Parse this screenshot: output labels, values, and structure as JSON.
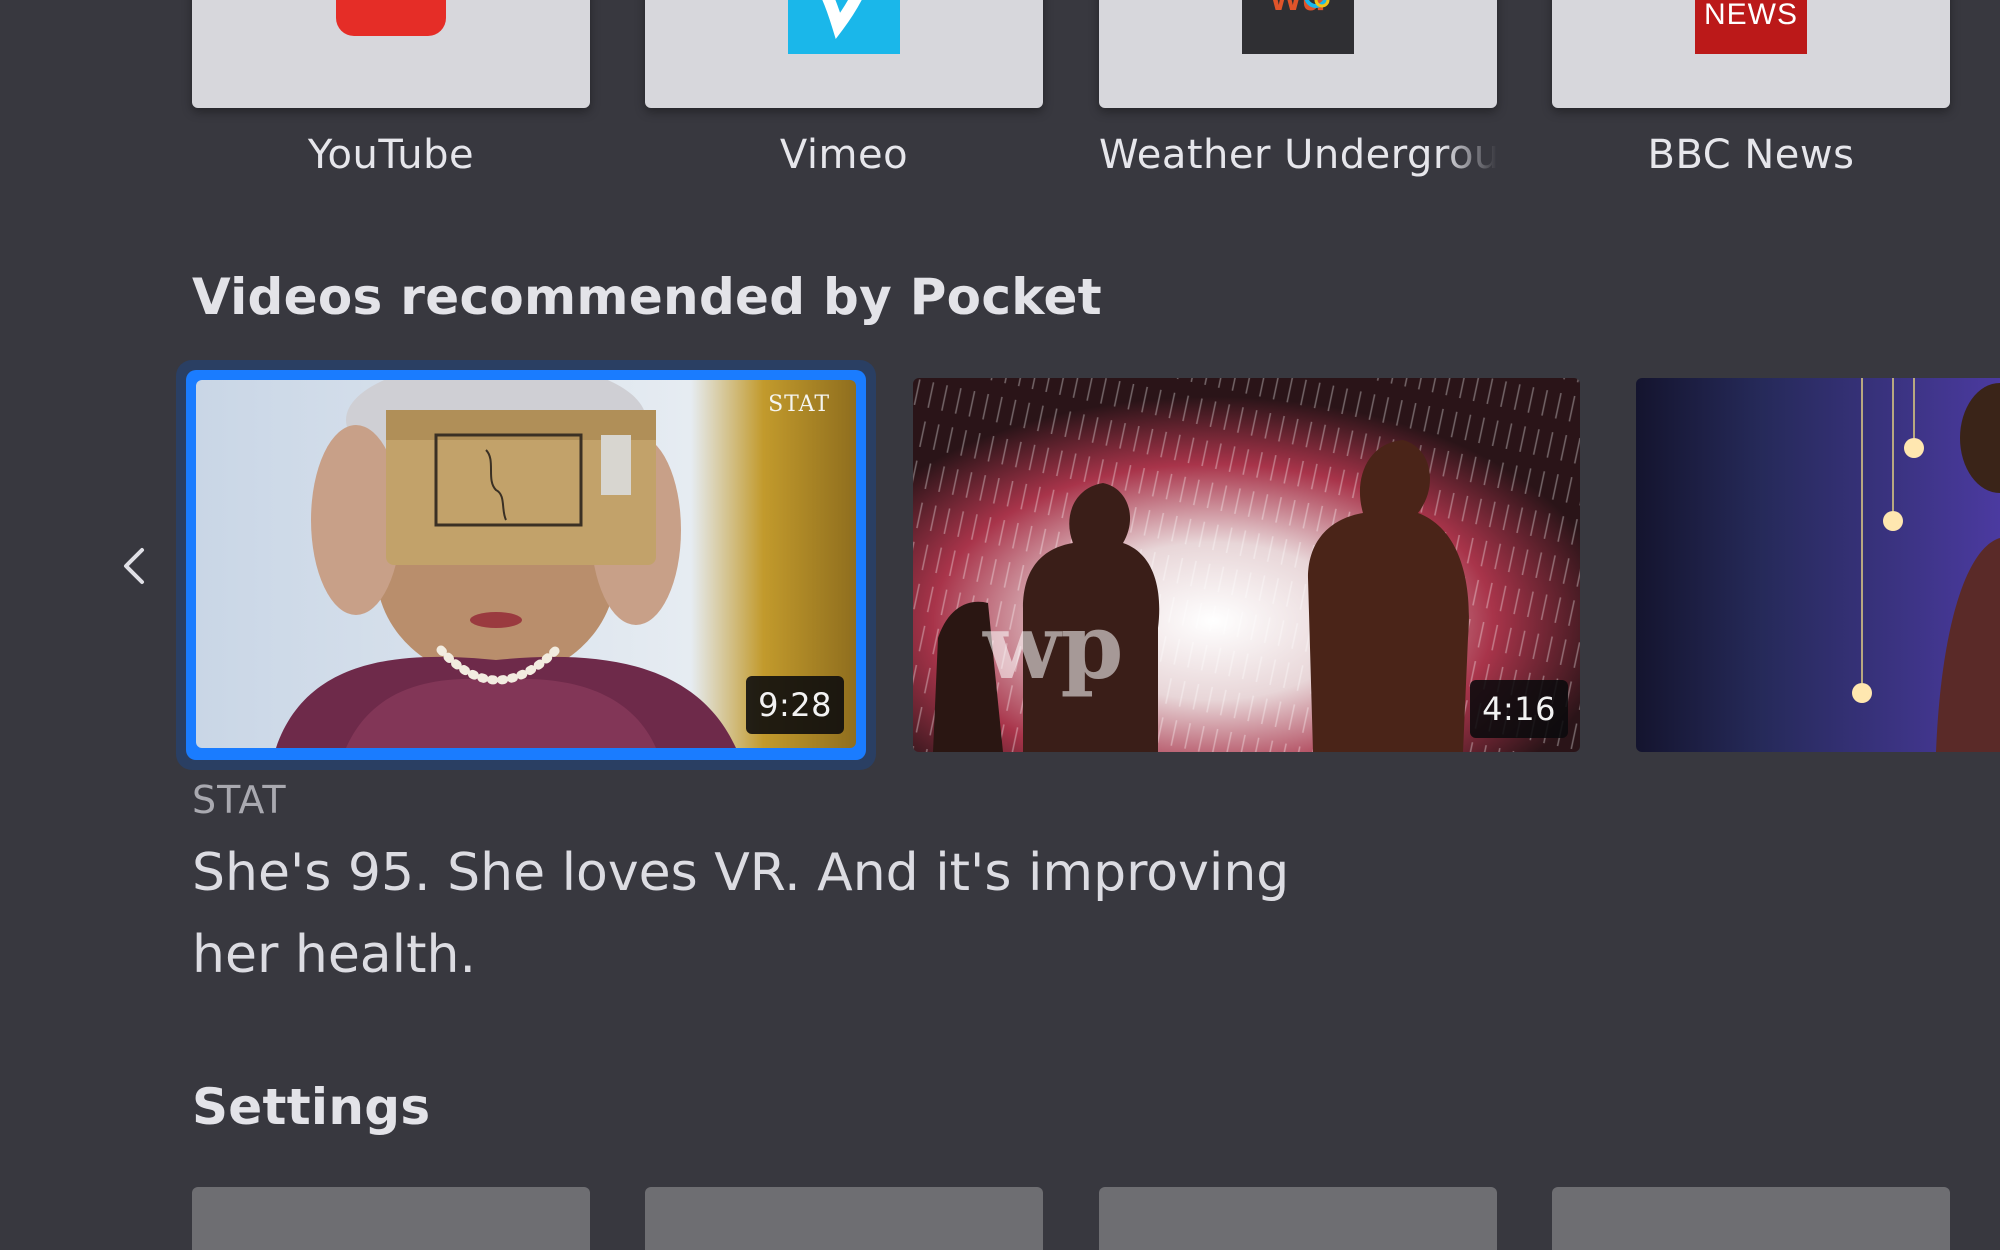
{
  "apps": [
    {
      "label": "YouTube",
      "icon": "youtube-logo",
      "brand_color": "#e52d27"
    },
    {
      "label": "Vimeo",
      "icon": "vimeo-logo",
      "brand_color": "#1ab7ea"
    },
    {
      "label": "Weather Undergrou",
      "icon": "weather-underground-logo",
      "brand_color": "#333333",
      "logo_text": "wu"
    },
    {
      "label": "BBC News",
      "icon": "bbc-news-logo",
      "brand_color": "#bb1919",
      "logo_text": "NEWS"
    }
  ],
  "pocket": {
    "heading": "Videos recommended by Pocket",
    "videos": [
      {
        "duration": "9:28",
        "watermark": "STAT",
        "focused": true
      },
      {
        "duration": "4:16",
        "watermark": "wp",
        "focused": false
      },
      {
        "duration": "",
        "focused": false
      }
    ],
    "selected": {
      "source": "STAT",
      "title": "She's 95. She loves VR. And it's improving her health."
    }
  },
  "settings": {
    "heading": "Settings"
  },
  "colors": {
    "background": "#38383f",
    "focus": "#1a7cff",
    "tile": "#d7d7dc"
  }
}
